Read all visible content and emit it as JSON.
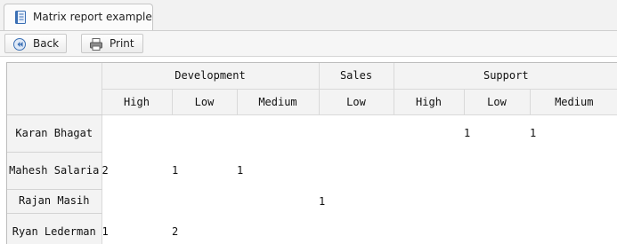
{
  "tab": {
    "label": "Matrix report example",
    "icon": "report-icon"
  },
  "toolbar": {
    "back_label": "Back",
    "back_icon": "back-arrow-icon",
    "print_label": "Print",
    "print_icon": "printer-icon"
  },
  "matrix": {
    "groups": [
      {
        "label": "Development",
        "span": 3
      },
      {
        "label": "Sales",
        "span": 1
      },
      {
        "label": "Support",
        "span": 3
      }
    ],
    "subheaders": [
      "High",
      "Low",
      "Medium",
      "Low",
      "High",
      "Low",
      "Medium"
    ],
    "rows": [
      {
        "label": "Karan Bhagat",
        "cells": [
          "",
          "",
          "",
          "",
          "",
          "1",
          "1"
        ]
      },
      {
        "label": "Mahesh Salaria",
        "cells": [
          "2",
          "1",
          "1",
          "",
          "",
          "",
          ""
        ]
      },
      {
        "label": "Rajan Masih",
        "cells": [
          "",
          "",
          "",
          "1",
          "",
          "",
          ""
        ]
      },
      {
        "label": "Ryan Lederman",
        "cells": [
          "1",
          "2",
          "",
          "",
          "",
          "",
          ""
        ]
      }
    ]
  },
  "colors": {
    "header_bg": "#f3f3f3",
    "tab_bg": "#fbfbfb",
    "toolbar_bg": "#f6f6f6",
    "icon_blue": "#3a6fb4"
  }
}
